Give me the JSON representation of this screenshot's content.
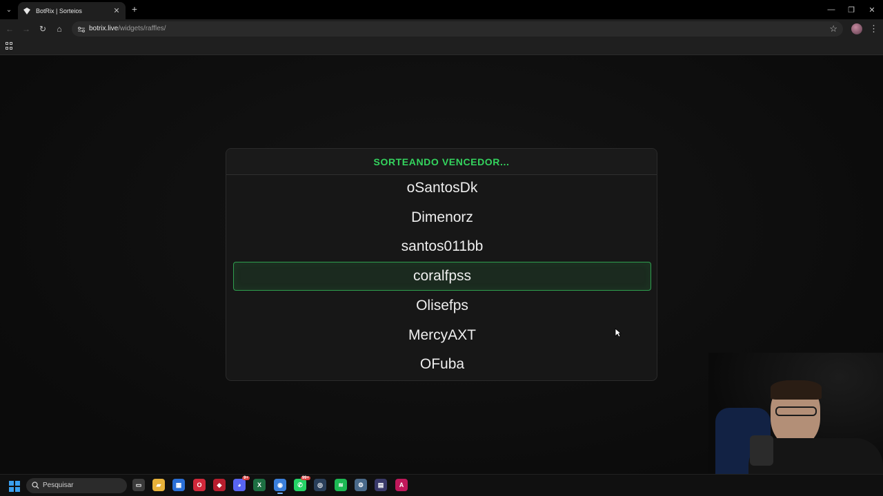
{
  "browser": {
    "tab_title": "BotRix | Sorteios",
    "url_host": "botrix.live",
    "url_path": "/widgets/raffles/",
    "controls": {
      "tab_list": "⌄",
      "close_tab": "✕",
      "new_tab": "+",
      "minimize": "—",
      "restore": "❐",
      "close_window": "✕",
      "back": "←",
      "forward": "→",
      "reload": "↻",
      "home": "⌂",
      "bookmark": "☆",
      "menu": "⋮"
    }
  },
  "raffle": {
    "status": "SORTEANDO VENCEDOR...",
    "accent_color": "#34d45e",
    "entries": [
      {
        "name": "oSantosDk",
        "selected": false
      },
      {
        "name": "Dimenorz",
        "selected": false
      },
      {
        "name": "santos011bb",
        "selected": false
      },
      {
        "name": "coralfpss",
        "selected": true
      },
      {
        "name": "Olisefps",
        "selected": false
      },
      {
        "name": "MercyAXT",
        "selected": false
      },
      {
        "name": "OFuba",
        "selected": false
      }
    ]
  },
  "taskbar": {
    "search_placeholder": "Pesquisar",
    "apps": [
      {
        "name": "task-view-icon",
        "glyph": "▭",
        "color": "#3b3b3b"
      },
      {
        "name": "file-explorer-icon",
        "glyph": "▰",
        "color": "#e8b23a"
      },
      {
        "name": "store-icon",
        "glyph": "▦",
        "color": "#2a6fd6"
      },
      {
        "name": "opera-icon",
        "glyph": "O",
        "color": "#d0283a"
      },
      {
        "name": "red-app-icon",
        "glyph": "◆",
        "color": "#b81e2e"
      },
      {
        "name": "discord-icon",
        "glyph": "◕",
        "color": "#5865f2",
        "badge": "9+"
      },
      {
        "name": "excel-icon",
        "glyph": "X",
        "color": "#1d6f42"
      },
      {
        "name": "chrome-icon",
        "glyph": "◉",
        "color": "#3a7fdc",
        "active": true
      },
      {
        "name": "whatsapp-icon",
        "glyph": "✆",
        "color": "#25d366",
        "badge": "99+"
      },
      {
        "name": "steam-icon",
        "glyph": "◎",
        "color": "#2a3f5a"
      },
      {
        "name": "spotify-icon",
        "glyph": "≋",
        "color": "#1db954"
      },
      {
        "name": "settings-icon",
        "glyph": "⚙",
        "color": "#4a6a8a"
      },
      {
        "name": "voice-app-icon",
        "glyph": "▤",
        "color": "#3a3a6a"
      },
      {
        "name": "font-app-icon",
        "glyph": "A",
        "color": "#c0185a"
      }
    ]
  }
}
